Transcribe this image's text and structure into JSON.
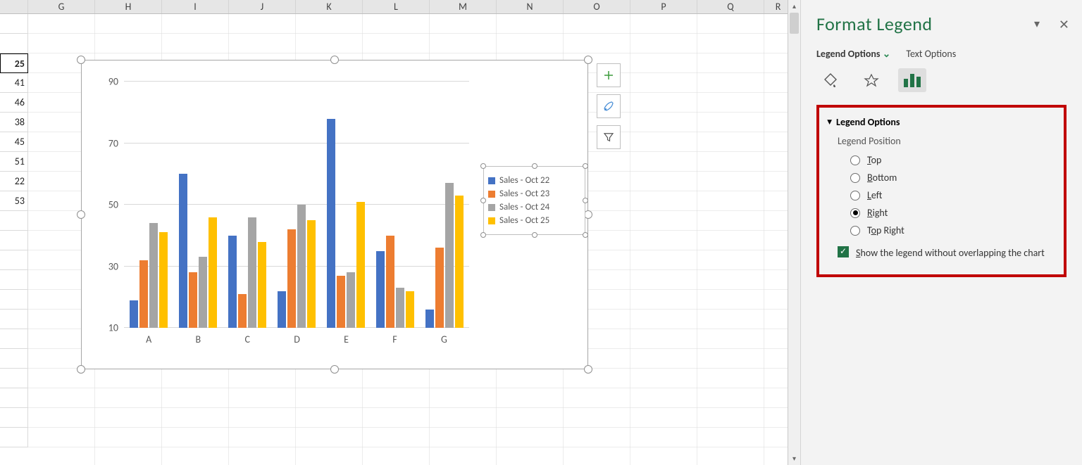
{
  "chart_data": {
    "type": "bar",
    "categories": [
      "A",
      "B",
      "C",
      "D",
      "E",
      "F",
      "G"
    ],
    "series": [
      {
        "name": "Sales - Oct 22",
        "values": [
          19,
          60,
          40,
          22,
          78,
          35,
          16
        ]
      },
      {
        "name": "Sales - Oct 23",
        "values": [
          32,
          28,
          21,
          42,
          27,
          40,
          36
        ]
      },
      {
        "name": "Sales - Oct 24",
        "values": [
          44,
          33,
          46,
          50,
          28,
          23,
          57
        ]
      },
      {
        "name": "Sales - Oct 25",
        "values": [
          41,
          46,
          38,
          45,
          51,
          22,
          53
        ]
      }
    ],
    "ylim": [
      10,
      90
    ],
    "ytick": [
      10,
      30,
      50,
      70,
      90
    ],
    "legend_position": "Right"
  },
  "columns": [
    "G",
    "H",
    "I",
    "J",
    "K",
    "L",
    "M",
    "N",
    "O",
    "P",
    "Q",
    "R"
  ],
  "side_column": [
    "25",
    "41",
    "46",
    "38",
    "45",
    "51",
    "22",
    "53"
  ],
  "legend": {
    "s1": "Sales - Oct 22",
    "s2": "Sales - Oct 23",
    "s3": "Sales - Oct 24",
    "s4": "Sales - Oct 25"
  },
  "pane": {
    "title": "Format Legend",
    "tab1": "Legend Options",
    "tab2": "Text Options",
    "section": "Legend Options",
    "subheader": "Legend Position",
    "pos_top": "Top",
    "pos_bottom": "Bottom",
    "pos_left": "Left",
    "pos_right": "Right",
    "pos_topright": "Top Right",
    "checkbox": "Show the legend without overlapping the chart"
  }
}
